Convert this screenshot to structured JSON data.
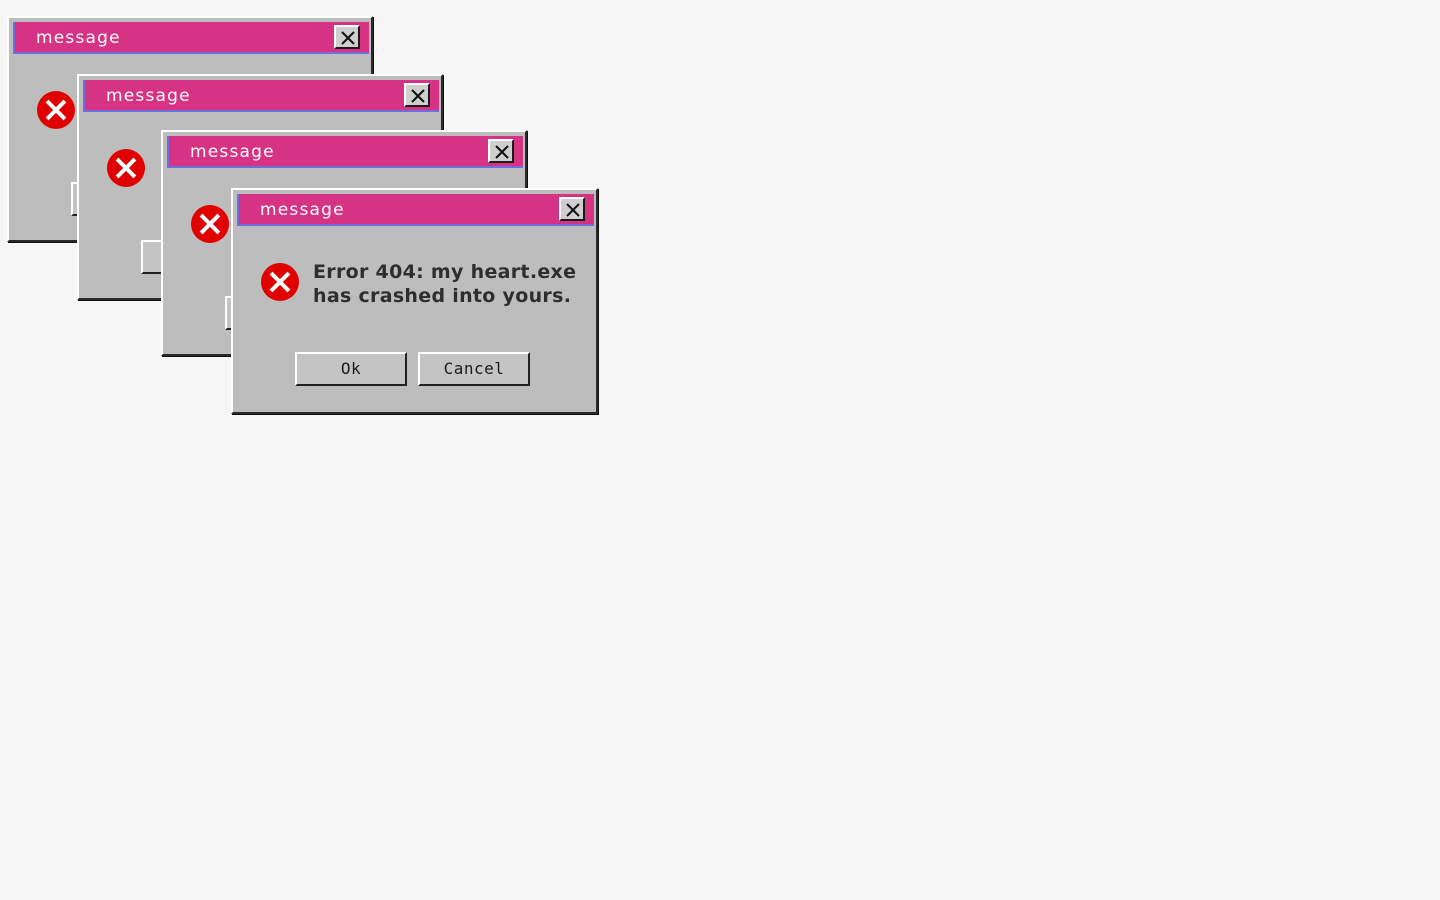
{
  "colors": {
    "background": "#f6f6f6",
    "titlebar": "#d63384",
    "window": "#bdbdbd",
    "error": "#e00000"
  },
  "dialogs": [
    {
      "title": "message",
      "icon": "error-icon",
      "message_line1": "",
      "message_line2": "",
      "ok_label": "",
      "cancel_label": ""
    },
    {
      "title": "message",
      "icon": "error-icon",
      "message_line1": "",
      "message_line2": "",
      "ok_label": "",
      "cancel_label": ""
    },
    {
      "title": "message",
      "icon": "error-icon",
      "message_line1": "",
      "message_line2": "",
      "ok_label": "",
      "cancel_label": ""
    },
    {
      "title": "message",
      "icon": "error-icon",
      "message_line1": "Error 404: my heart.exe",
      "message_line2": "has crashed into yours.",
      "ok_label": "Ok",
      "cancel_label": "Cancel"
    }
  ]
}
